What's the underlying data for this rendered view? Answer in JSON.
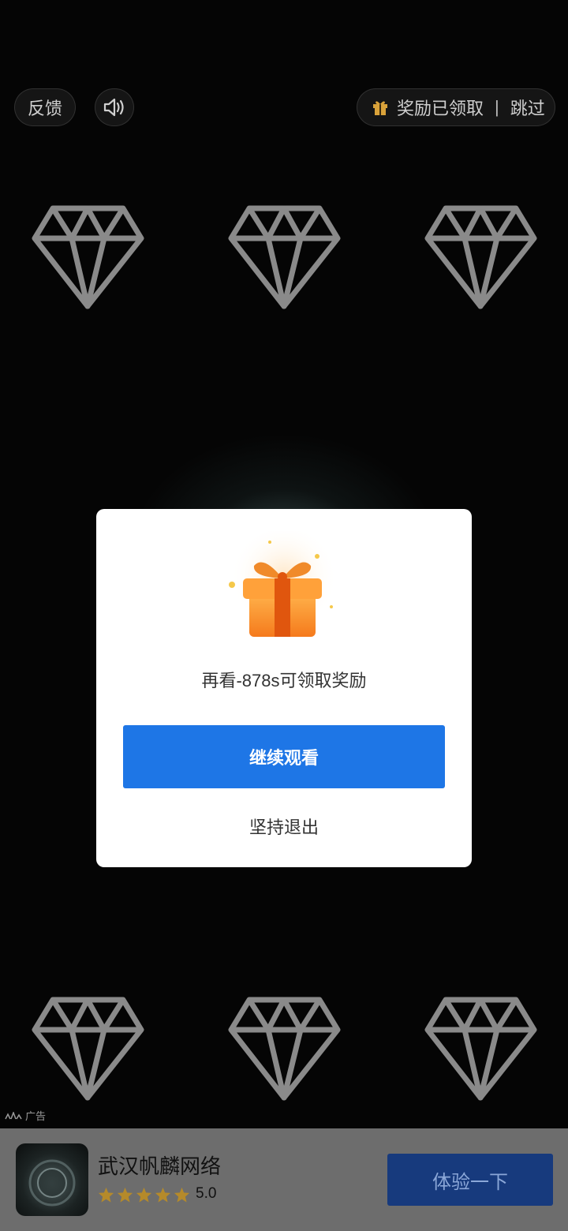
{
  "top_bar": {
    "feedback_label": "反馈",
    "sound_icon": "speaker-icon",
    "reward_status": "奖励已领取",
    "divider": "|",
    "skip_label": "跳过"
  },
  "dialog": {
    "gift_icon": "gift-box-icon",
    "message": "再看-878s可领取奖励",
    "continue_label": "继续观看",
    "quit_label": "坚持退出"
  },
  "ad_banner": {
    "ad_tag": "广告",
    "app_name": "武汉帆麟网络",
    "rating": "5.0",
    "stars": 5,
    "cta_label": "体验一下",
    "cta_color": "#173a7d"
  },
  "colors": {
    "primary_button": "#1e76e6",
    "star": "#b58a2a",
    "gift": "#f27a1a"
  }
}
